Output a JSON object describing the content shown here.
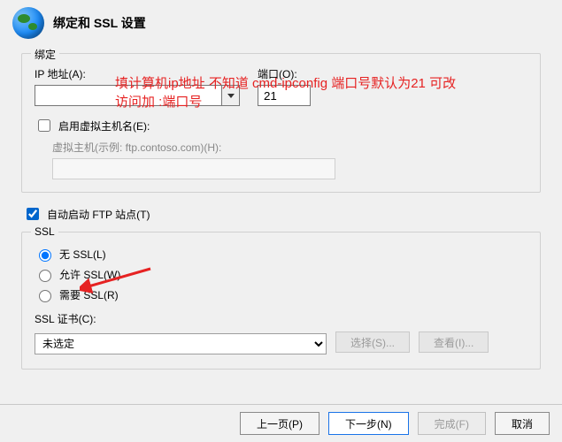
{
  "header": {
    "title": "绑定和 SSL 设置"
  },
  "annotation": {
    "line1": "填计算机ip地址 不知道 cmd-ipconfig 端口号默认为21 可改",
    "line2": "访问加  :端口号"
  },
  "binding": {
    "legend": "绑定",
    "ip_label": "IP 地址(A):",
    "ip_value": "",
    "port_label": "端口(O):",
    "port_value": "21",
    "enable_vh_label": "启用虚拟主机名(E):",
    "vh_label": "虚拟主机(示例: ftp.contoso.com)(H):",
    "vh_value": ""
  },
  "autostart": {
    "label": "自动启动 FTP 站点(T)"
  },
  "ssl": {
    "legend": "SSL",
    "no_ssl": "无 SSL(L)",
    "allow_ssl": "允许 SSL(W)",
    "require_ssl": "需要 SSL(R)",
    "cert_label": "SSL 证书(C):",
    "cert_value": "未选定",
    "select_btn": "选择(S)...",
    "view_btn": "查看(I)..."
  },
  "footer": {
    "prev": "上一页(P)",
    "next": "下一步(N)",
    "finish": "完成(F)",
    "cancel": "取消"
  },
  "watermark": ""
}
